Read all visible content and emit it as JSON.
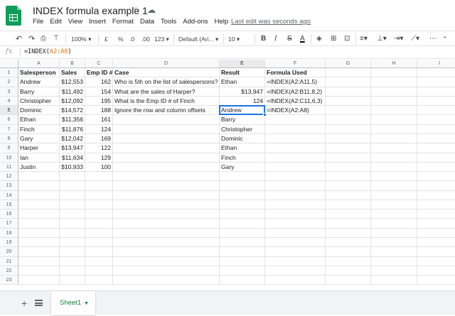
{
  "title": "INDEX formula example 1",
  "menu": [
    "File",
    "Edit",
    "View",
    "Insert",
    "Format",
    "Data",
    "Tools",
    "Add-ons",
    "Help"
  ],
  "last_edit": "Last edit was seconds ago",
  "toolbar": {
    "zoom": "100%",
    "currency": "£",
    "percent": "%",
    "dec_decrease": ".0",
    "dec_increase": ".00",
    "more_formats": "123",
    "font": "Default (Ari...",
    "font_size": "10",
    "bold": "B",
    "italic": "I",
    "strike": "S",
    "text_color": "A"
  },
  "formula_bar": {
    "fx": "fx",
    "prefix": "=INDEX(",
    "ref": "A2:A8",
    "suffix": ")"
  },
  "columns": [
    "A",
    "B",
    "C",
    "D",
    "E",
    "F",
    "G",
    "H",
    "I"
  ],
  "rows": [
    "1",
    "2",
    "3",
    "4",
    "5",
    "6",
    "7",
    "8",
    "9",
    "10",
    "11",
    "12",
    "13",
    "14",
    "15",
    "16",
    "17",
    "18",
    "19",
    "20",
    "21",
    "22",
    "23"
  ],
  "cells": {
    "A1": "Salesperson",
    "B1": "Sales",
    "C1": "Emp ID #",
    "D1": "Case",
    "E1": "Result",
    "F1": "Formula Used",
    "A2": "Andrew",
    "B2": "$12,553",
    "C2": "162",
    "D2": "Who is 5th on the list of salespersons?",
    "E2": "Ethan",
    "F2": "=INDEX(A2:A11,5)",
    "A3": "Barry",
    "B3": "$11,492",
    "C3": "154",
    "D3": "What are the sales of Harper?",
    "E3": "$13,947",
    "F3": "=INDEX(A2:B11,8,2)",
    "A4": "Christopher",
    "B4": "$12,092",
    "C4": "195",
    "D4": "What is the Emp ID # of Finch",
    "E4": "124",
    "F4": "=INDEX(A2:C11,6,3)",
    "A5": "Dominic",
    "B5": "$14,572",
    "C5": "188",
    "D5": "Ignore the row and column offsets",
    "E5": "Andrew",
    "F5": "=INDEX(A2:A8)",
    "A6": "Ethan",
    "B6": "$11,356",
    "C6": "161",
    "E6": "Barry",
    "A7": "Finch",
    "B7": "$11,876",
    "C7": "124",
    "E7": "Christopher",
    "A8": "Gary",
    "B8": "$12,042",
    "C8": "169",
    "E8": "Dominic",
    "A9": "Harper",
    "B9": "$13,947",
    "C9": "122",
    "E9": "Ethan",
    "A10": "Ian",
    "B10": "$11,634",
    "C10": "129",
    "E10": "Finch",
    "A11": "Justin",
    "B11": "$10,933",
    "C11": "100",
    "E11": "Gary"
  },
  "numeric_cells": [
    "B2",
    "B3",
    "B4",
    "B5",
    "B6",
    "B7",
    "B8",
    "B9",
    "B10",
    "B11",
    "C2",
    "C3",
    "C4",
    "C5",
    "C6",
    "C7",
    "C8",
    "C9",
    "C10",
    "C11",
    "E3",
    "E4"
  ],
  "bold_cells": [
    "A1",
    "B1",
    "C1",
    "D1",
    "E1",
    "F1"
  ],
  "selected_cell": "E5",
  "sheet_tab": "Sheet1",
  "colors": {
    "accent": "#1a73e8",
    "sheets_green": "#0f9d58",
    "formula_ref": "#e8710a",
    "tab_text": "#188038"
  }
}
